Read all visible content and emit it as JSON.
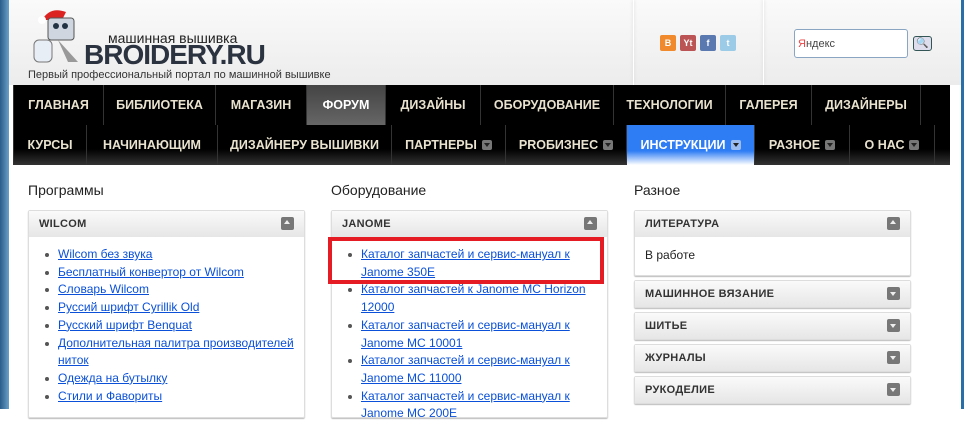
{
  "header": {
    "logo_tagline": "машинная вышивка",
    "logo_text": "BROIDERY.RU",
    "slogan": "Первый профессиональный портал по машинной вышивке",
    "social": [
      "blogger-icon",
      "youtube-icon",
      "facebook-icon",
      "twitter-icon"
    ],
    "search_placeholder_y": "Я",
    "search_placeholder_rest": "ндекс"
  },
  "nav": {
    "row1": [
      "ГЛАВНАЯ",
      "БИБЛИОТЕКА",
      "МАГАЗИН",
      "ФОРУМ",
      "ДИЗАЙНЫ",
      "ОБОРУДОВАНИЕ",
      "ТЕХНОЛОГИИ",
      "ГАЛЕРЕЯ",
      "ДИЗАЙНЕРЫ"
    ],
    "row2": [
      "КУРСЫ",
      "НАЧИНАЮЩИМ",
      "ДИЗАЙНЕРУ ВЫШИВКИ",
      "ПАРТНЕРЫ",
      "PROБИЗНЕС",
      "ИНСТРУКЦИИ",
      "РАЗНОЕ",
      "О НАС"
    ],
    "active_row1": "ФОРУМ",
    "active_row2": "ИНСТРУКЦИИ"
  },
  "columns": [
    {
      "title": "Программы",
      "panels": [
        {
          "title": "WILCOM",
          "items": [
            "Wilcom без звука",
            "Бесплатный конвертор от Wilcom",
            "Словарь Wilcom",
            "Руссий шрифт Cyrillik Old",
            "Русский шрифт Benquat",
            "Дополнительная палитра производителей ниток",
            "Одежда на бутылку",
            "Стили и Фавориты"
          ]
        }
      ]
    },
    {
      "title": "Оборудование",
      "panels": [
        {
          "title": "JANOME",
          "items": [
            "Каталог запчастей и сервис-мануал к Janome 350E",
            "Каталог запчастей к Janome MC Horizon 12000",
            "Каталог запчастей и сервис-мануал к Janome MC 10001",
            "Каталог запчастей и сервис-мануал к Janome MC 11000",
            "Каталог запчастей и сервис-мануал к Janome MC 200E"
          ]
        }
      ]
    },
    {
      "title": "Разное",
      "panels": [
        {
          "title": "ЛИТЕРАТУРА",
          "body": "В работе"
        },
        {
          "title": "МАШИННОЕ ВЯЗАНИЕ"
        },
        {
          "title": "ШИТЬЕ"
        },
        {
          "title": "ЖУРНАЛЫ"
        },
        {
          "title": "РУКОДЕЛИЕ"
        }
      ]
    }
  ],
  "colors": {
    "accent": "#2f7df5",
    "highlight": "#e51c23",
    "link": "#0a50d8"
  }
}
